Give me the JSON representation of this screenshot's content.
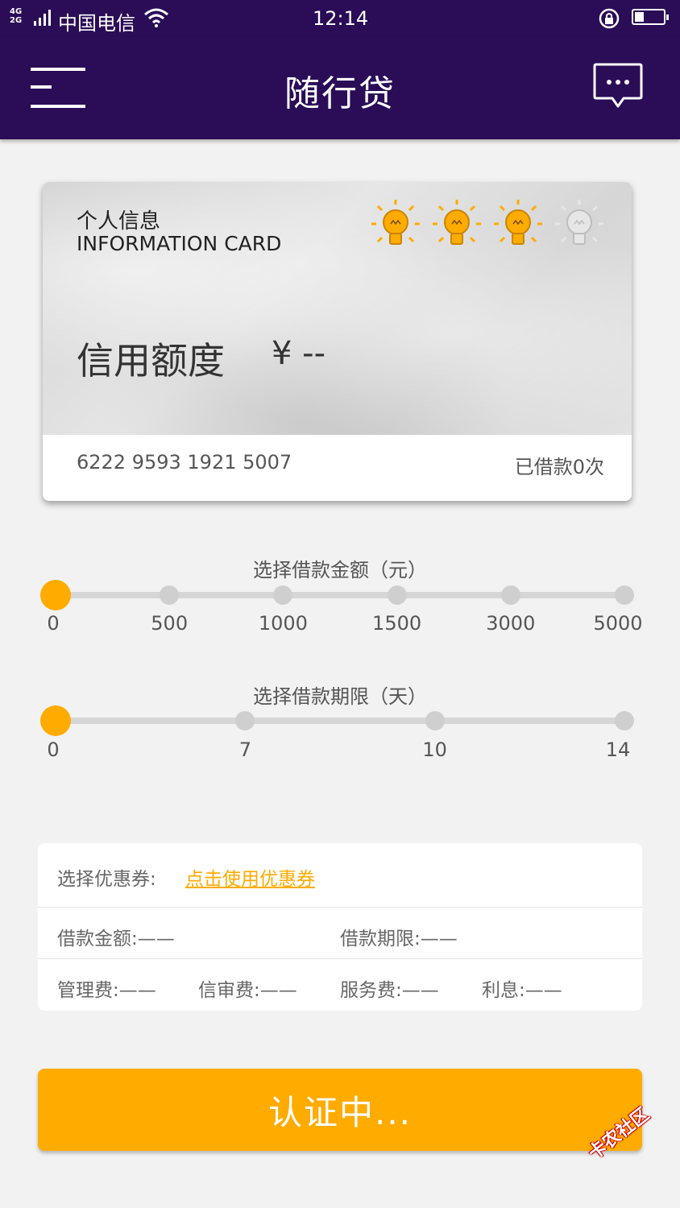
{
  "status_bar": {
    "network_top": "4G",
    "network_bottom": "2G",
    "carrier": "中国电信",
    "time": "12:14",
    "battery_level": 0.3
  },
  "header": {
    "title": "随行贷",
    "menu_icon": "hamburger-menu-icon",
    "message_icon": "chat-bubble-icon"
  },
  "card": {
    "title_zh": "个人信息",
    "title_en": "INFORMATION CARD",
    "credit_label": "信用额度",
    "credit_value": "¥ --",
    "rating_total": 4,
    "rating_active": 3,
    "card_number": "6222 9593 1921 5007",
    "borrow_count": "已借款0次"
  },
  "amount_slider": {
    "title": "选择借款金额（元）",
    "ticks": [
      "0",
      "500",
      "1000",
      "1500",
      "3000",
      "5000"
    ],
    "selected": "0"
  },
  "term_slider": {
    "title": "选择借款期限（天）",
    "ticks": [
      "0",
      "7",
      "10",
      "14"
    ],
    "selected": "0"
  },
  "summary": {
    "coupon_label": "选择优惠券:",
    "coupon_link": "点击使用优惠券",
    "loan_amount": "借款金额:——",
    "loan_term": "借款期限:——",
    "management_fee": "管理费:——",
    "review_fee": "信审费:——",
    "service_fee": "服务费:——",
    "interest": "利息:——"
  },
  "action": {
    "button_label": "认证中..."
  },
  "watermark": {
    "text": "卡农社区"
  },
  "colors": {
    "header_bg": "#2a0c57",
    "accent": "#ffab00",
    "page_bg": "#f2f2f2"
  }
}
